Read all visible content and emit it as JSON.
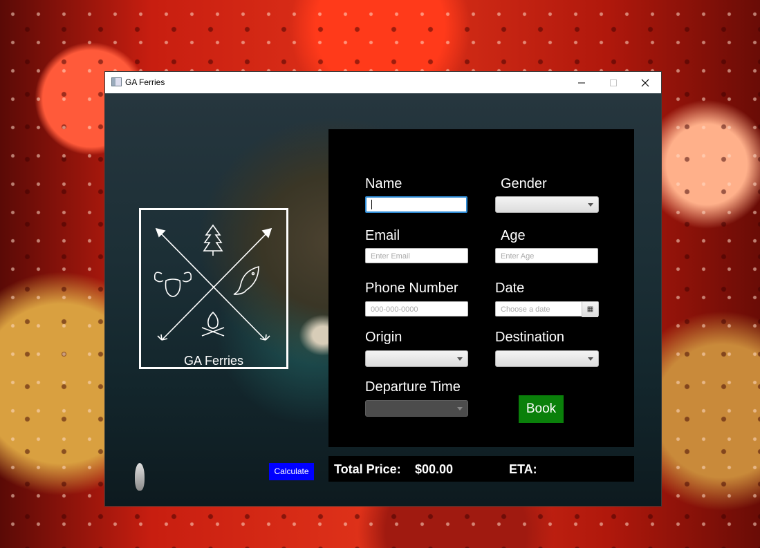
{
  "window": {
    "title": "GA Ferries"
  },
  "logo": {
    "text": "GA Ferries"
  },
  "form": {
    "name_label": "Name",
    "name_value": "",
    "gender_label": "Gender",
    "gender_value": "",
    "email_label": "Email",
    "email_placeholder": "Enter Email",
    "age_label": "Age",
    "age_placeholder": "Enter Age",
    "phone_label": "Phone Number",
    "phone_placeholder": "000-000-0000",
    "date_label": "Date",
    "date_placeholder": "Choose a date",
    "origin_label": "Origin",
    "origin_value": "",
    "destination_label": "Destination",
    "destination_value": "",
    "departure_label": "Departure Time",
    "departure_value": "",
    "book_label": "Book"
  },
  "summary": {
    "total_price_label": "Total Price:",
    "total_price_value": "$00.00",
    "eta_label": "ETA:",
    "eta_value": ""
  },
  "calculate_label": "Calculate",
  "icons": [
    "app-icon",
    "minimize-icon",
    "maximize-icon",
    "close-icon",
    "calendar-icon",
    "chevron-down-icon",
    "tree-icon",
    "moose-icon",
    "fish-icon",
    "campfire-icon",
    "arrow-icon"
  ]
}
